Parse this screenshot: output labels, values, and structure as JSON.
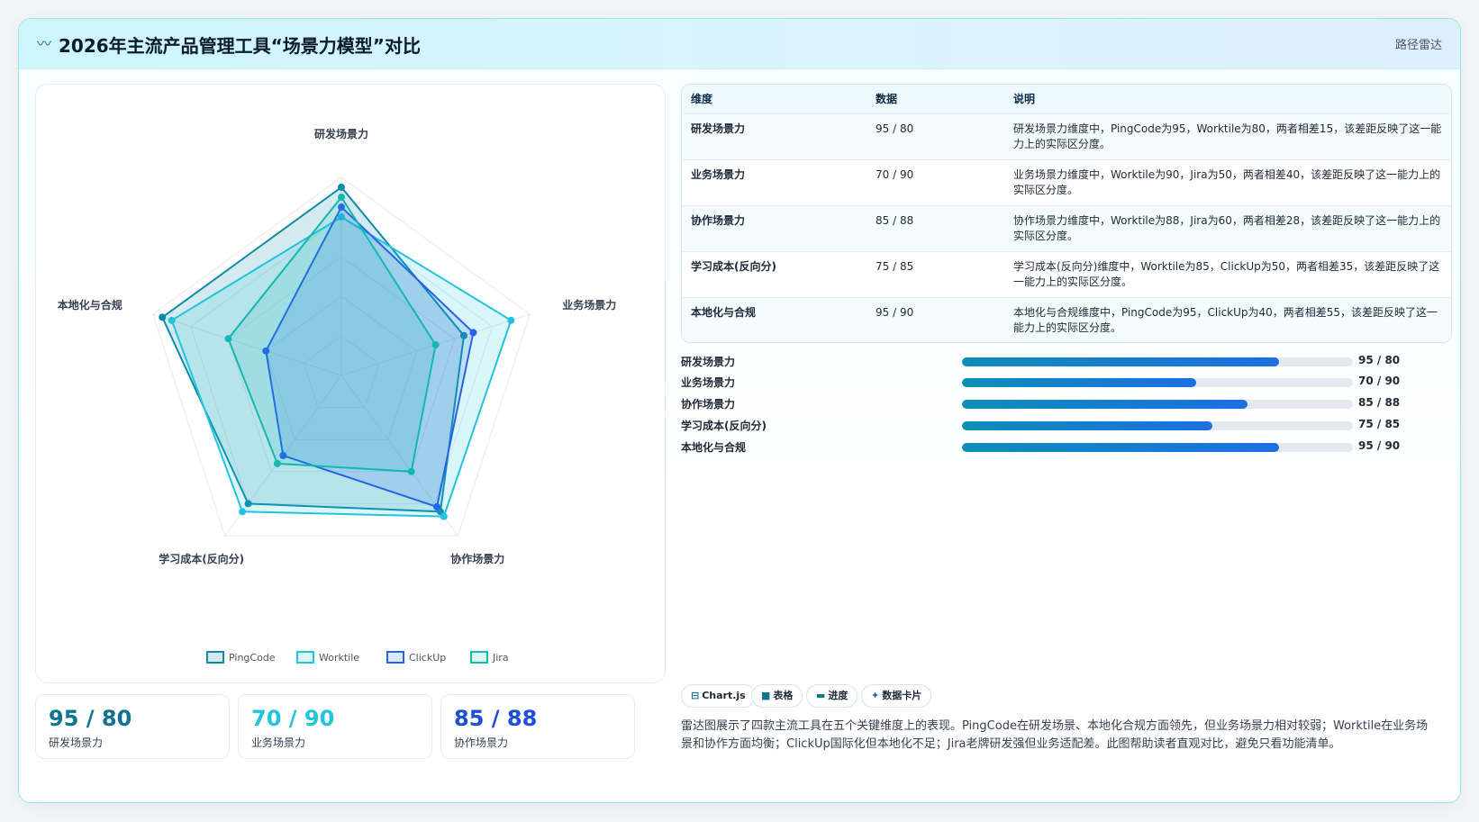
{
  "header": {
    "title": "2026年主流产品管理工具“场景力模型”对比",
    "logo_icon": "wave-icon",
    "tag": "路径雷达"
  },
  "colors": {
    "pingcode": "#0e8aa8",
    "worktile": "#22c4dc",
    "clickup": "#2563eb",
    "jira": "#14b8b0"
  },
  "chart_data": {
    "type": "radar",
    "title": "",
    "categories": [
      "研发场景力",
      "业务场景力",
      "协作场景力",
      "学习成本(反向分)",
      "本地化与合规"
    ],
    "rlim": [
      0,
      100
    ],
    "grid": true,
    "legend": "bottom",
    "series": [
      {
        "name": "PingCode",
        "values": [
          95,
          65,
          85,
          80,
          95
        ]
      },
      {
        "name": "Worktile",
        "values": [
          80,
          90,
          88,
          85,
          90
        ]
      },
      {
        "name": "ClickUp",
        "values": [
          85,
          70,
          82,
          50,
          40
        ]
      },
      {
        "name": "Jira",
        "values": [
          90,
          50,
          60,
          55,
          60
        ]
      }
    ]
  },
  "stats": [
    {
      "value": "95 / 80",
      "label": "研发场景力",
      "color": "#0e7490"
    },
    {
      "value": "70 / 90",
      "label": "业务场景力",
      "color": "#22c4dc"
    },
    {
      "value": "85 / 88",
      "label": "协作场景力",
      "color": "#1d4ed8"
    }
  ],
  "table": {
    "headers": [
      "维度",
      "数据",
      "说明"
    ],
    "rows": [
      {
        "dim": "研发场景力",
        "data": "95 / 80",
        "note": "研发场景力维度中，PingCode为95，Worktile为80，两者相差15，该差距反映了这一能力上的实际区分度。"
      },
      {
        "dim": "业务场景力",
        "data": "70 / 90",
        "note": "业务场景力维度中，Worktile为90，Jira为50，两者相差40，该差距反映了这一能力上的实际区分度。"
      },
      {
        "dim": "协作场景力",
        "data": "85 / 88",
        "note": "协作场景力维度中，Worktile为88，Jira为60，两者相差28，该差距反映了这一能力上的实际区分度。"
      },
      {
        "dim": "学习成本(反向分)",
        "data": "75 / 85",
        "note": "学习成本(反向分)维度中，Worktile为85，ClickUp为50，两者相差35，该差距反映了这一能力上的实际区分度。"
      },
      {
        "dim": "本地化与合规",
        "data": "95 / 90",
        "note": "本地化与合规维度中，PingCode为95，ClickUp为40，两者相差55，该差距反映了这一能力上的实际区分度。"
      }
    ]
  },
  "bars": [
    {
      "label": "研发场景力",
      "value": "95 / 80",
      "progress": 0.81
    },
    {
      "label": "业务场景力",
      "value": "70 / 90",
      "progress": 0.6
    },
    {
      "label": "协作场景力",
      "value": "85 / 88",
      "progress": 0.73
    },
    {
      "label": "学习成本(反向分)",
      "value": "75 / 85",
      "progress": 0.64
    },
    {
      "label": "本地化与合规",
      "value": "95 / 90",
      "progress": 0.81
    }
  ],
  "chips": [
    {
      "icon": "chart-icon",
      "glyph": "⊟",
      "label": "Chart.js"
    },
    {
      "icon": "table-icon",
      "glyph": "■",
      "label": "表格"
    },
    {
      "icon": "progress-icon",
      "glyph": "▬",
      "label": "进度"
    },
    {
      "icon": "sparkle-icon",
      "glyph": "✦",
      "label": "数据卡片"
    }
  ],
  "description": "雷达图展示了四款主流工具在五个关键维度上的表现。PingCode在研发场景、本地化合规方面领先，但业务场景力相对较弱；Worktile在业务场景和协作方面均衡；ClickUp国际化但本地化不足；Jira老牌研发强但业务适配差。此图帮助读者直观对比，避免只看功能清单。"
}
